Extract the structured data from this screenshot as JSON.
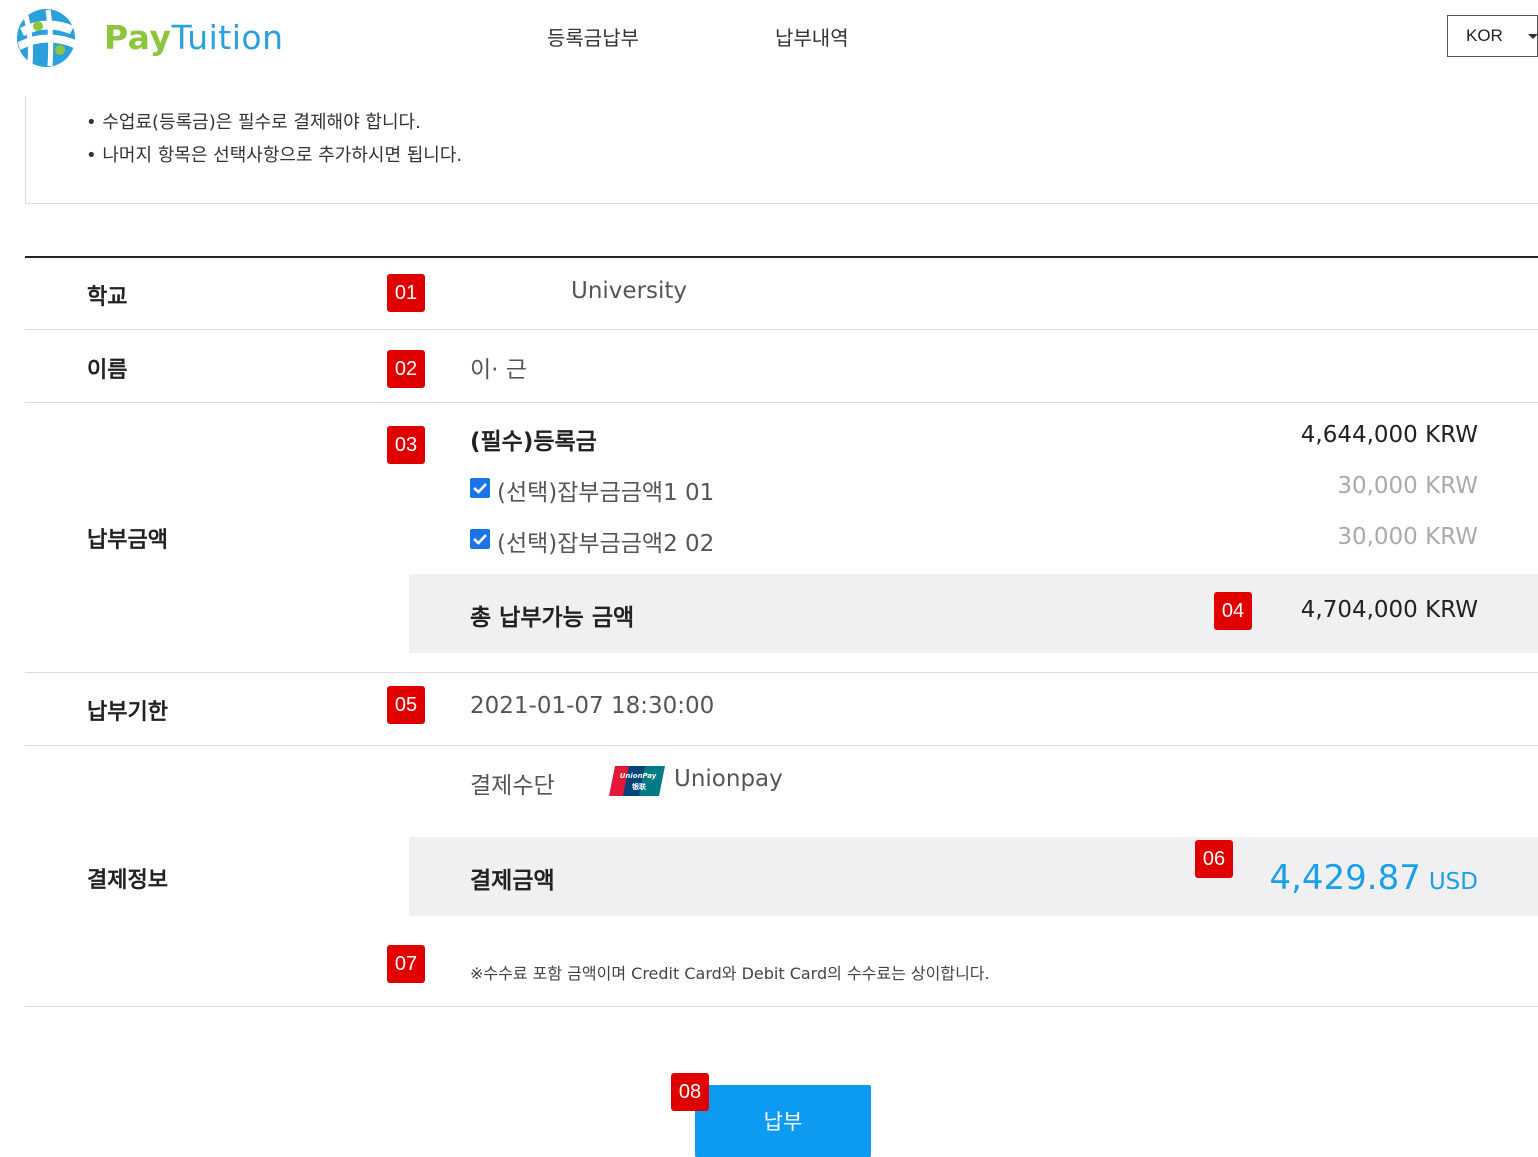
{
  "header": {
    "logo_pay": "Pay",
    "logo_tuition": "Tuition",
    "nav": [
      "등록금납부",
      "납부내역"
    ],
    "language": "KOR"
  },
  "notice": {
    "lines": [
      "• 수업료(등록금)은 필수로 결제해야 합니다.",
      "• 나머지 항목은 선택사항으로 추가하시면 됩니다."
    ]
  },
  "form": {
    "school": {
      "label": "학교",
      "badge": "01",
      "value": "University"
    },
    "name": {
      "label": "이름",
      "badge": "02",
      "value": "이·  근"
    },
    "amount": {
      "label": "납부금액",
      "badge": "03",
      "items": [
        {
          "name": "(필수)등록금",
          "amount": "4,644,000 KRW",
          "checked": null
        },
        {
          "name": "(선택)잡부금금액1 01",
          "amount": "30,000 KRW",
          "checked": true
        },
        {
          "name": "(선택)잡부금금액2 02",
          "amount": "30,000 KRW",
          "checked": true
        }
      ],
      "total_label": "총 납부가능 금액",
      "total_badge": "04",
      "total_value": "4,704,000 KRW"
    },
    "deadline": {
      "label": "납부기한",
      "badge": "05",
      "value": "2021-01-07 18:30:00"
    },
    "payment": {
      "label": "결제정보",
      "method_label": "결제수단",
      "method_value": "Unionpay",
      "method_icon": "unionpay-logo",
      "amount_label": "결제금액",
      "amount_badge": "06",
      "amount_value": "4,429.87",
      "amount_currency": "USD",
      "note_badge": "07",
      "note": "※수수료 포함 금액이며 Credit Card와 Debit Card의 수수료는 상이합니다."
    }
  },
  "submit": {
    "badge": "08",
    "label": "납부"
  },
  "colors": {
    "accent_blue": "#0c9bf0",
    "usd_blue": "#1aa0e8",
    "badge_red": "#e00000",
    "logo_green": "#8cc63f",
    "logo_blue": "#2ba0dd"
  }
}
